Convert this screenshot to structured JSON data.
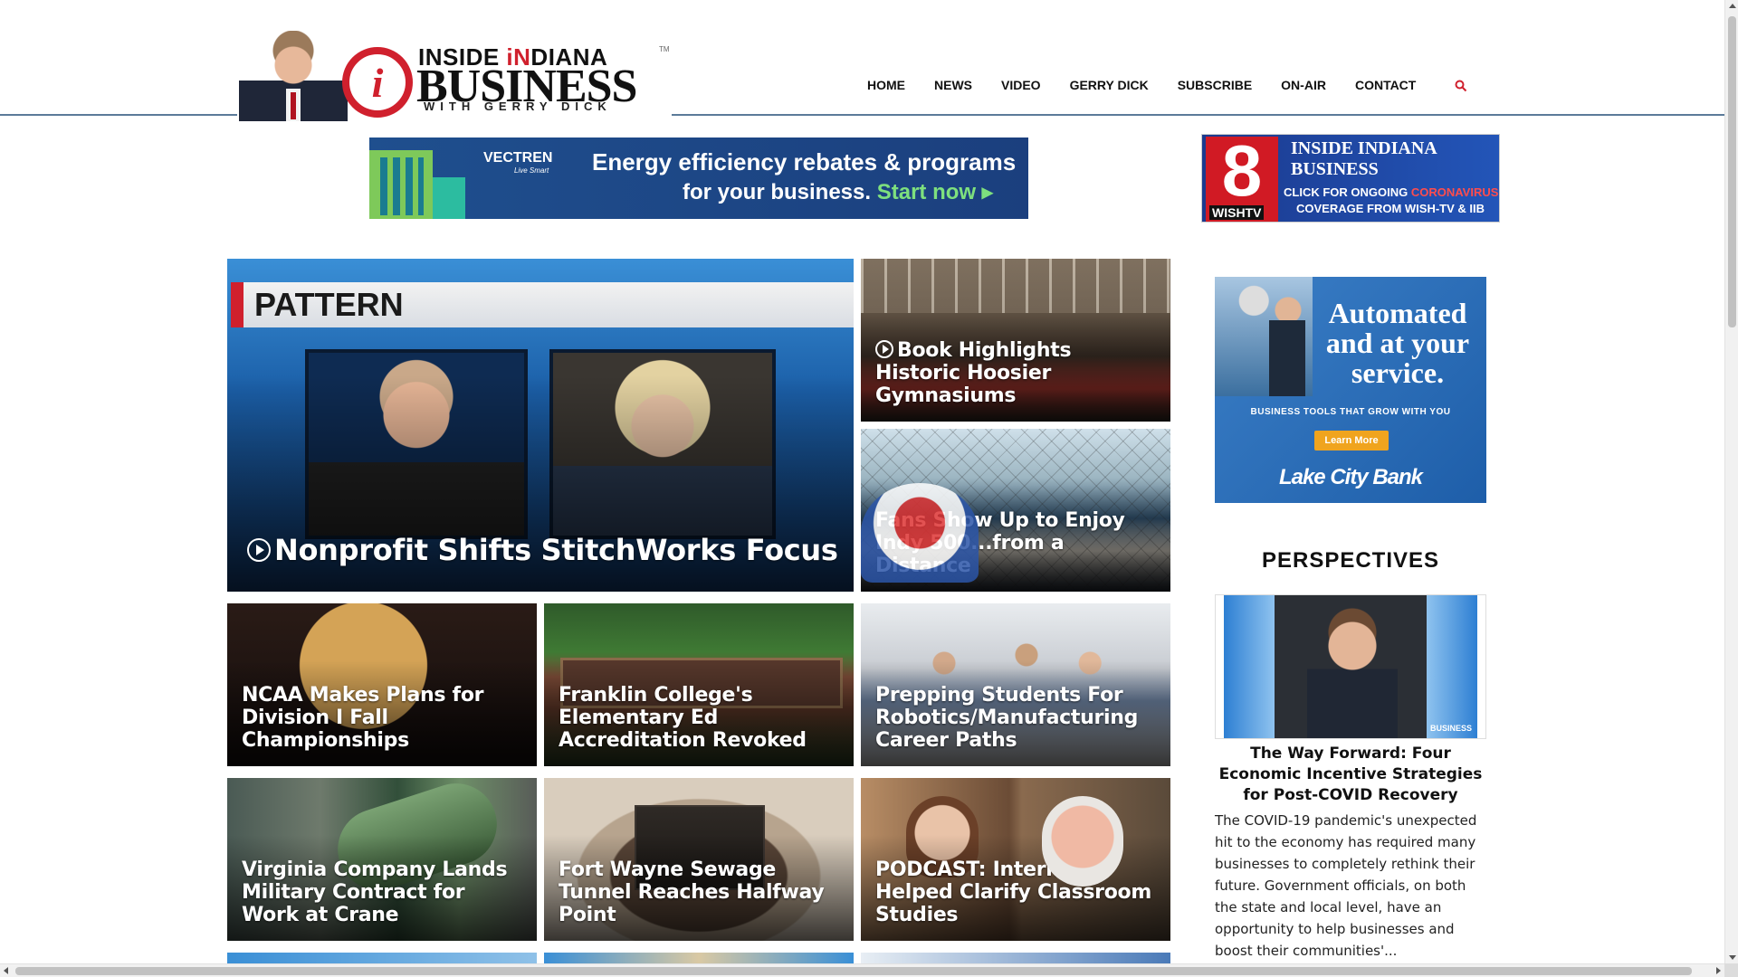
{
  "logo": {
    "line1_a": "INSIDE ",
    "line1_accent": "iN",
    "line1_b": "DIANA",
    "line2": "BUSINESS",
    "line3": "WITH GERRY DICK",
    "mark": "i",
    "tm": "TM"
  },
  "nav": {
    "items": [
      "HOME",
      "NEWS",
      "VIDEO",
      "GERRY DICK",
      "SUBSCRIBE",
      "ON-AIR",
      "CONTACT"
    ],
    "search_icon": "search-icon",
    "accent_color": "#d0202d"
  },
  "ads": {
    "vectren": {
      "brand": "VECTREN",
      "tagline": "Live Smart",
      "line1": "Energy efficiency rebates & programs",
      "line2": "for your business.",
      "cta": "Start now"
    },
    "wish": {
      "channel": "8",
      "station": "WISHTV",
      "title": "INSIDE INDIANA BUSINESS",
      "line1_a": "CLICK FOR ONGOING ",
      "line1_red": "CORONAVIRUS",
      "line2": "COVERAGE FROM WISH-TV & IIB"
    },
    "lakecity": {
      "headline": "Automated and at your service.",
      "sub": "BUSINESS TOOLS THAT GROW WITH YOU",
      "button": "Learn More",
      "bank": "Lake City Bank"
    }
  },
  "hero": {
    "banner": "PATTERN",
    "caption": "Nonprofit Shifts StitchWorks Focus"
  },
  "stories": {
    "gym": "Book Highlights Historic Hoosier Gymnasiums",
    "fans": "Fans Show Up to Enjoy Indy 500...from a Distance",
    "ncaa": "NCAA Makes Plans for Division I Fall Championships",
    "franklin": "Franklin College's Elementary Ed Accreditation Revoked",
    "robotics": "Prepping Students For Robotics/Manufacturing Career Paths",
    "virginia": "Virginia Company Lands Military Contract for Work at Crane",
    "tunnel": "Fort Wayne Sewage Tunnel Reaches Halfway Point",
    "podcast": "PODCAST: Internship Helped Clarify Classroom Studies"
  },
  "perspectives": {
    "title": "PERSPECTIVES",
    "headline": "The Way Forward: Four Economic Incentive Strategies for Post-COVID Recovery",
    "body": "The COVID-19 pandemic's unexpected hit to the economy has required many businesses to completely rethink their future. Government officials, on both the state and local level, have an opportunity to help businesses and boost their communities'...",
    "image_badge": "BUSINESS"
  }
}
